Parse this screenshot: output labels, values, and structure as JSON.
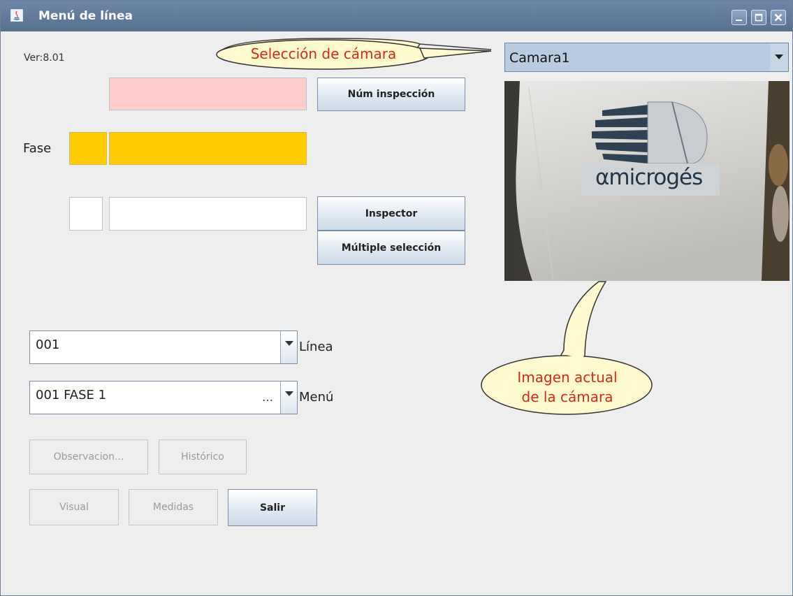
{
  "window": {
    "title": "Menú de línea",
    "version": "Ver:8.01",
    "controls": [
      "minimize-icon",
      "maximize-icon",
      "close-icon"
    ]
  },
  "form": {
    "inspeccion_button": "Núm inspección",
    "fase_label": "Fase",
    "inspector_button": "Inspector",
    "multiple_button": "Múltiple selección",
    "linea_value": "001",
    "linea_label": "Línea",
    "menu_value": "001 FASE 1",
    "menu_ellipsis": "…",
    "menu_label": "Menú",
    "observaciones_button": "Observacion...",
    "historico_button": "Histórico",
    "visual_button": "Visual",
    "medidas_button": "Medidas",
    "salir_button": "Salir"
  },
  "camera": {
    "selected": "Camara1",
    "logo_text": "αmicrogés"
  },
  "callouts": {
    "camera_select": "Selección de cámara",
    "camera_image_line1": "Imagen actual",
    "camera_image_line2": "de la cámara"
  },
  "colors": {
    "titlebar": "#5f7a9c",
    "pink_field": "#ffcccc",
    "fase_field": "#ffcc00",
    "callout_fill": "#fffacd",
    "callout_text": "#d42b1b"
  }
}
